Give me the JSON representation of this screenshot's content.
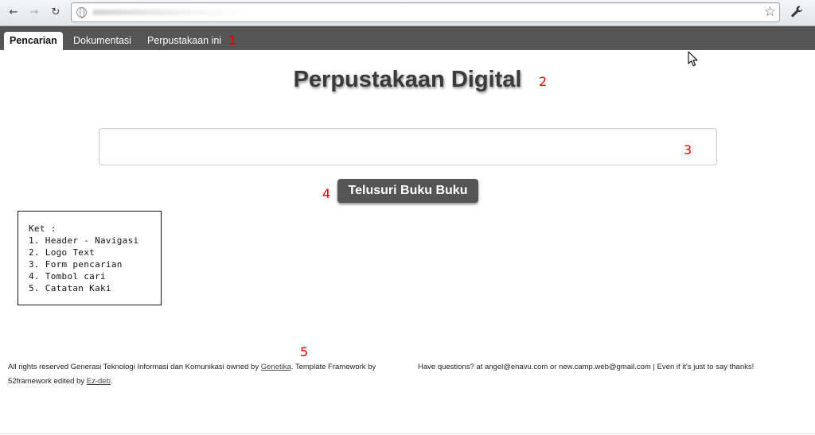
{
  "browser": {
    "back_glyph": "←",
    "forward_glyph": "→",
    "reload_glyph": "↻",
    "star_glyph": "☆",
    "wrench_glyph": "🔧",
    "icons": [
      "back-icon",
      "forward-icon",
      "reload-icon",
      "globe-icon",
      "star-icon",
      "wrench-icon"
    ]
  },
  "nav": {
    "tabs": [
      {
        "label": "Pencarian",
        "active": true
      },
      {
        "label": "Dokumentasi",
        "active": false
      },
      {
        "label": "Perpustakaan ini",
        "active": false
      }
    ]
  },
  "annotations": {
    "n1": "1",
    "n2": "2",
    "n3": "3",
    "n4": "4",
    "n5": "5"
  },
  "logo": {
    "text": "Perpustakaan Digital"
  },
  "search": {
    "value": "",
    "button_label": "Telusuri Buku Buku"
  },
  "legend": {
    "title": "Ket :",
    "items": [
      "1. Header - Navigasi",
      "2. Logo Text",
      "3. Form pencarian",
      "4. Tombol cari",
      "5. Catatan Kaki"
    ]
  },
  "footer": {
    "left_prefix": "All rights reserved Generasi Teknologi Informasi dan Komunikasi owned by ",
    "left_link1": "Genetika",
    "left_middle": ". Template Framework by",
    "left_line2_prefix": "52framework edited by ",
    "left_link2": "Ez-deb",
    "left_suffix": ".",
    "right_text": "Have questions? at angel@enavu.com or new.camp.web@gmail.com | Even if it's just to say thanks!"
  },
  "colors": {
    "nav_bg": "#555555",
    "button_bg": "#555555",
    "annotation_red": "#e00000",
    "logo_text": "#3a3a3a"
  }
}
